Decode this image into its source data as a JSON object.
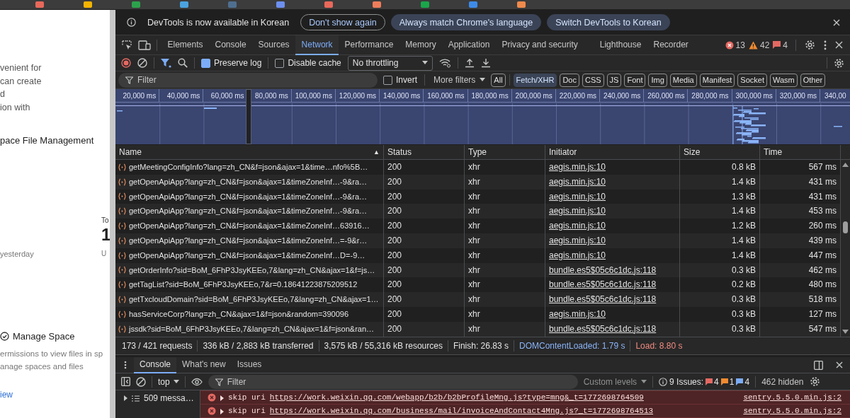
{
  "tab_strip": {
    "favicons": [
      {
        "color": "#e8685a"
      },
      {
        "color": "#f4b400"
      },
      {
        "color": "#2ca24c"
      },
      {
        "color": "#4aa3df"
      },
      {
        "color": "#4f6f90"
      },
      {
        "color": "#6d8ff0"
      },
      {
        "color": "#e8685a"
      },
      {
        "color": "#ef7d5a"
      },
      {
        "color": "#1aa64a"
      },
      {
        "color": "#3d8be8"
      },
      {
        "color": "#f08a4b"
      }
    ]
  },
  "page": {
    "lines": [
      "venient for",
      "can create",
      "d",
      "ion with"
    ],
    "heading": "pace File Management",
    "stat_label": "To",
    "stat_value": "1",
    "stat_caption": "yesterday",
    "stat_caption_2": "U",
    "section_title": "Manage Space",
    "section_lines": [
      "ermissions to view files in sp",
      "anage spaces and files"
    ],
    "link": "iew"
  },
  "infobar": {
    "message": "DevTools is now available in Korean",
    "buttons": [
      "Don't show again",
      "Always match Chrome's language",
      "Switch DevTools to Korean"
    ]
  },
  "panel_tabs": [
    {
      "label": "Elements",
      "selected": false
    },
    {
      "label": "Console",
      "selected": false
    },
    {
      "label": "Sources",
      "selected": false
    },
    {
      "label": "Network",
      "selected": true
    },
    {
      "label": "Performance",
      "selected": false
    },
    {
      "label": "Memory",
      "selected": false
    },
    {
      "label": "Application",
      "selected": false
    },
    {
      "label": "Privacy and security",
      "selected": false
    },
    {
      "label": "Lighthouse",
      "selected": false
    },
    {
      "label": "Recorder",
      "selected": false
    }
  ],
  "counts": {
    "errors": "13",
    "warnings": "42",
    "issues": "4"
  },
  "toolbar": {
    "recording": true,
    "filter_active": true,
    "preserve_log": {
      "label": "Preserve log",
      "checked": true
    },
    "disable_cache": {
      "label": "Disable cache",
      "checked": false
    },
    "throttling": "No throttling"
  },
  "filter_bar": {
    "placeholder": "Filter",
    "invert": {
      "label": "Invert",
      "checked": false
    },
    "more_filters": "More filters",
    "types": [
      {
        "label": "All",
        "selected": false
      },
      {
        "label": "Fetch/XHR",
        "selected": true
      },
      {
        "label": "Doc",
        "selected": false
      },
      {
        "label": "CSS",
        "selected": false
      },
      {
        "label": "JS",
        "selected": false
      },
      {
        "label": "Font",
        "selected": false
      },
      {
        "label": "Img",
        "selected": false
      },
      {
        "label": "Media",
        "selected": false
      },
      {
        "label": "Manifest",
        "selected": false
      },
      {
        "label": "Socket",
        "selected": false
      },
      {
        "label": "Wasm",
        "selected": false
      },
      {
        "label": "Other",
        "selected": false
      }
    ]
  },
  "overview": {
    "ticks": [
      "20,000 ms",
      "40,000 ms",
      "60,000 ms",
      "80,000 ms",
      "100,000 ms",
      "120,000 ms",
      "140,000 ms",
      "160,000 ms",
      "180,000 ms",
      "200,000 ms",
      "220,000 ms",
      "240,000 ms",
      "260,000 ms",
      "280,000 ms",
      "300,000 ms",
      "320,000 ms",
      "340,00"
    ]
  },
  "table": {
    "columns": [
      "Name",
      "Status",
      "Type",
      "Initiator",
      "Size",
      "Time"
    ],
    "sort_indicator": "▲",
    "rows": [
      {
        "name": "getMeetingConfigInfo?lang=zh_CN&f=json&ajax=1&time…nfo%5B…",
        "status": "200",
        "type": "xhr",
        "initiator": "aegis.min.js:10",
        "size": "0.8 kB",
        "time": "567 ms"
      },
      {
        "name": "getOpenApiApp?lang=zh_CN&f=json&ajax=1&timeZoneInf…-9&ra…",
        "status": "200",
        "type": "xhr",
        "initiator": "aegis.min.js:10",
        "size": "1.4 kB",
        "time": "431 ms"
      },
      {
        "name": "getOpenApiApp?lang=zh_CN&f=json&ajax=1&timeZoneInf…-9&ra…",
        "status": "200",
        "type": "xhr",
        "initiator": "aegis.min.js:10",
        "size": "1.3 kB",
        "time": "431 ms"
      },
      {
        "name": "getOpenApiApp?lang=zh_CN&f=json&ajax=1&timeZoneInf…-9&ra…",
        "status": "200",
        "type": "xhr",
        "initiator": "aegis.min.js:10",
        "size": "1.4 kB",
        "time": "453 ms"
      },
      {
        "name": "getOpenApiApp?lang=zh_CN&f=json&ajax=1&timeZoneInf…63916…",
        "status": "200",
        "type": "xhr",
        "initiator": "aegis.min.js:10",
        "size": "1.2 kB",
        "time": "260 ms"
      },
      {
        "name": "getOpenApiApp?lang=zh_CN&f=json&ajax=1&timeZoneInf…=-9&r…",
        "status": "200",
        "type": "xhr",
        "initiator": "aegis.min.js:10",
        "size": "1.4 kB",
        "time": "439 ms"
      },
      {
        "name": "getOpenApiApp?lang=zh_CN&f=json&ajax=1&timeZoneInf…D=-9…",
        "status": "200",
        "type": "xhr",
        "initiator": "aegis.min.js:10",
        "size": "1.4 kB",
        "time": "447 ms"
      },
      {
        "name": "getOrderInfo?sid=BoM_6FhP3JsyKEEo,7&lang=zh_CN&ajax=1&f=js…",
        "status": "200",
        "type": "xhr",
        "initiator": "bundle.es5$05c6c1dc.js:118",
        "size": "0.3 kB",
        "time": "462 ms"
      },
      {
        "name": "getTagList?sid=BoM_6FhP3JsyKEEo,7&r=0.18641223875209512",
        "status": "200",
        "type": "xhr",
        "initiator": "bundle.es5$05c6c1dc.js:118",
        "size": "0.2 kB",
        "time": "480 ms"
      },
      {
        "name": "getTxcloudDomain?sid=BoM_6FhP3JsyKEEo,7&lang=zh_CN&ajax=1…",
        "status": "200",
        "type": "xhr",
        "initiator": "bundle.es5$05c6c1dc.js:118",
        "size": "0.3 kB",
        "time": "518 ms"
      },
      {
        "name": "hasServiceCorp?lang=zh_CN&ajax=1&f=json&random=390096",
        "status": "200",
        "type": "xhr",
        "initiator": "aegis.min.js:10",
        "size": "0.3 kB",
        "time": "127 ms"
      },
      {
        "name": "jssdk?sid=BoM_6FhP3JsyKEEo,7&lang=zh_CN&ajax=1&f=json&ran…",
        "status": "200",
        "type": "xhr",
        "initiator": "bundle.es5$05c6c1dc.js:118",
        "size": "0.3 kB",
        "time": "547 ms"
      }
    ]
  },
  "summary": [
    {
      "text": "173 / 421 requests",
      "kind": "plain"
    },
    {
      "text": "336 kB / 2,883 kB transferred",
      "kind": "plain"
    },
    {
      "text": "3,575 kB / 55,316 kB resources",
      "kind": "plain"
    },
    {
      "text": "Finish: 26.83 s",
      "kind": "plain"
    },
    {
      "text": "DOMContentLoaded: 1.79 s",
      "kind": "dom"
    },
    {
      "text": "Load: 8.80 s",
      "kind": "load"
    }
  ],
  "drawer": {
    "tabs": [
      {
        "label": "Console",
        "selected": true
      },
      {
        "label": "What's new",
        "selected": false
      },
      {
        "label": "Issues",
        "selected": false
      }
    ],
    "context": "top",
    "filter_placeholder": "Filter",
    "levels": "Custom levels",
    "issues_label": "9 Issues:",
    "issue_counts": {
      "errors": "4",
      "warnings": "1",
      "info": "4"
    },
    "hidden": "462 hidden",
    "sidebar": [
      {
        "label": "509 messa…"
      }
    ],
    "messages": [
      {
        "kind": "error",
        "prefix": "skip uri",
        "url": "https://work.weixin.qq.com/webapp/b2b/b2bProfileMng.js?type=mng&_t=1772698764509",
        "source": "sentry.5.5.0.min.js:2"
      },
      {
        "kind": "error",
        "prefix": "skip uri",
        "url": "https://work.weixin.qq.com/business/mail/invoiceAndContact4Mng.js?_t=1772698764513",
        "source": "sentry.5.5.0.min.js:2"
      }
    ]
  }
}
